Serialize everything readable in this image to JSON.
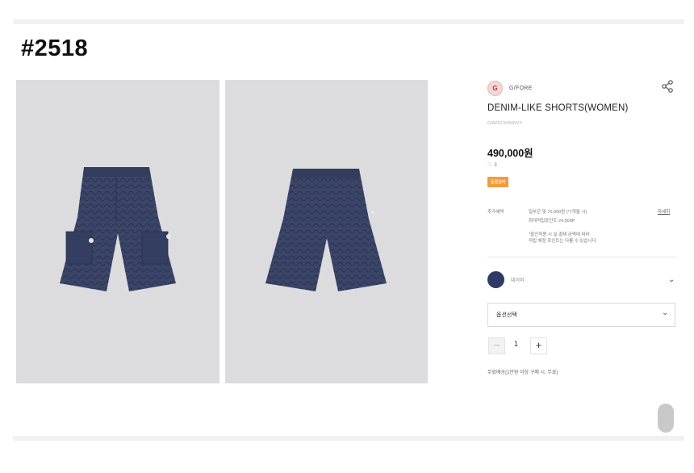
{
  "page": {
    "title": "#2518"
  },
  "gallery": [
    {
      "view": "front"
    },
    {
      "view": "back"
    }
  ],
  "colors": {
    "fabric": "#3b4567",
    "background": "#dcdcde",
    "badge": "#f39c3d",
    "swatch": "#2f3a66"
  },
  "product": {
    "brand_logo_text": "G",
    "brand_name": "G/FORE",
    "name": "DENIM-LIKE SHORTS(WOMEN)",
    "code": "G4WS23H60NVY",
    "price": "490,000원",
    "like_count": "3",
    "badge": "품절임박"
  },
  "benefits": {
    "label": "추가혜택",
    "line1": "일부은 및 70,000원 (*7개월 시)",
    "line2": "최대적립포인트 24,500P",
    "note1": "*할인적용 시 실 결제 금액에 따라",
    "note2": "적립 예정 포인트는 다를 수 있습니다.",
    "more": "자세히"
  },
  "color_option": {
    "name": "네이비"
  },
  "option_select": {
    "placeholder": "옵션선택"
  },
  "quantity": {
    "value": "1",
    "minus": "−",
    "plus": "+"
  },
  "shipping": {
    "text": "무료배송(1만원 이상 구매 시, 무료)"
  },
  "icons": [
    "share-icon",
    "heart-icon",
    "chevron-down-icon",
    "brand-logo-icon"
  ]
}
